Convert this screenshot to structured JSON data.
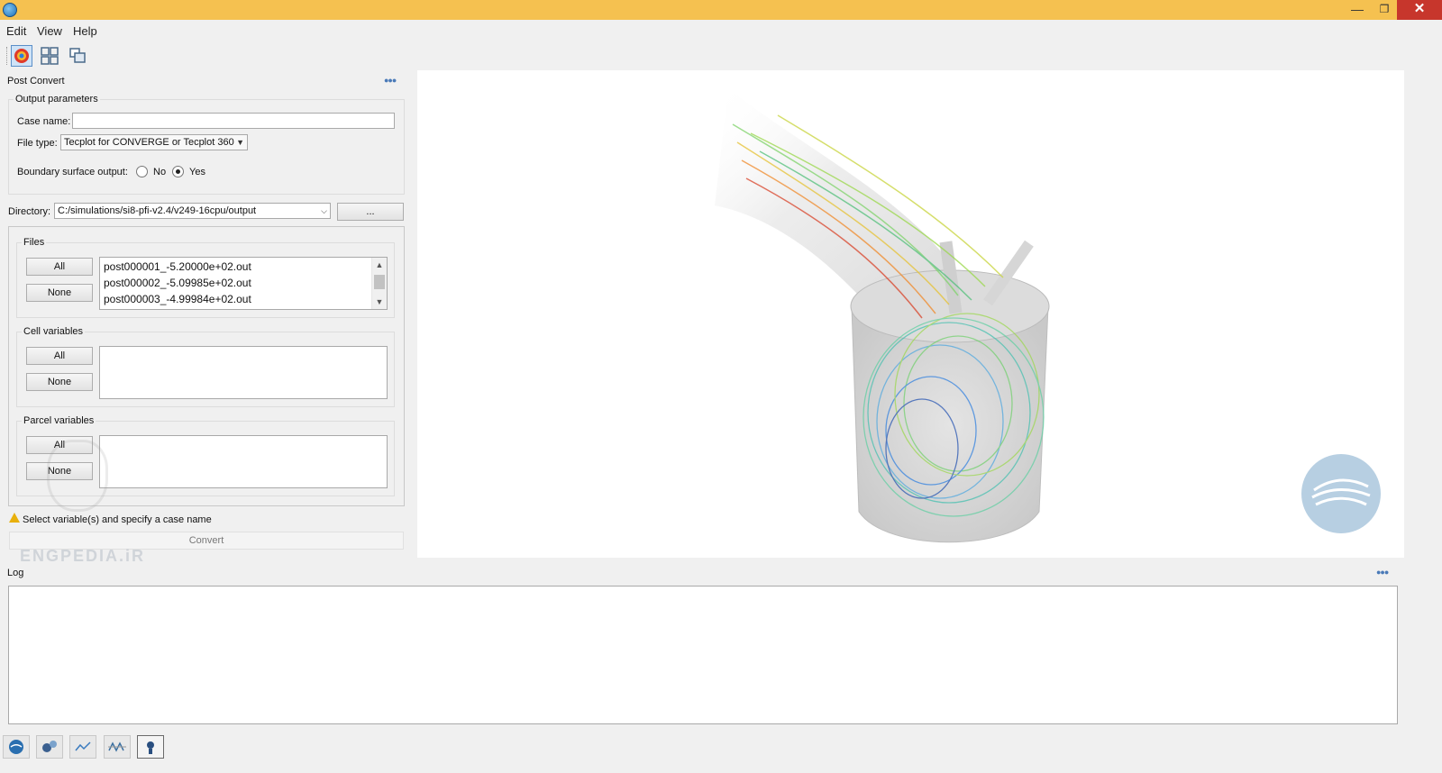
{
  "window": {
    "minimize": "—",
    "maximize": "❐",
    "close": "✕"
  },
  "menu": [
    "Edit",
    "View",
    "Help"
  ],
  "panel": {
    "title": "Post Convert",
    "output_parameters": {
      "title": "Output parameters",
      "case_name_label": "Case name:",
      "case_name_value": "",
      "file_type_label": "File type:",
      "file_type_value": "Tecplot for CONVERGE or Tecplot 360",
      "boundary_label": "Boundary surface output:",
      "boundary_no": "No",
      "boundary_yes": "Yes",
      "boundary_selected": "Yes"
    },
    "directory": {
      "label": "Directory:",
      "value": "C:/simulations/si8-pfi-v2.4/v249-16cpu/output",
      "browse_label": "..."
    },
    "files": {
      "title": "Files",
      "all_label": "All",
      "none_label": "None",
      "items": [
        "post000001_-5.20000e+02.out",
        "post000002_-5.09985e+02.out",
        "post000003_-4.99984e+02.out"
      ]
    },
    "cell_variables": {
      "title": "Cell variables",
      "all_label": "All",
      "none_label": "None"
    },
    "parcel_variables": {
      "title": "Parcel variables",
      "all_label": "All",
      "none_label": "None"
    },
    "warning": "Select variable(s) and specify a case name",
    "convert_label": "Convert",
    "watermark": "ENGPEDIA.iR"
  },
  "log": {
    "title": "Log"
  },
  "colors": {
    "titlebar": "#f5c150",
    "close": "#c7362c",
    "accent": "#4a7ab8"
  }
}
